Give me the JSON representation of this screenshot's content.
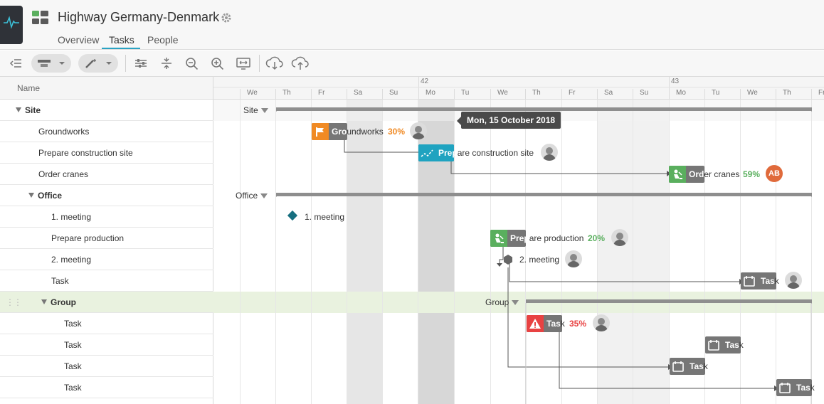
{
  "app": {
    "title": "Highway Germany-Denmark"
  },
  "tabs": [
    {
      "label": "Overview"
    },
    {
      "label": "Tasks"
    },
    {
      "label": "People"
    }
  ],
  "grid": {
    "column_name": "Name",
    "rows": [
      {
        "label": "Site"
      },
      {
        "label": "Groundworks"
      },
      {
        "label": "Prepare construction site"
      },
      {
        "label": "Order cranes"
      },
      {
        "label": "Office"
      },
      {
        "label": "1. meeting"
      },
      {
        "label": "Prepare production"
      },
      {
        "label": "2. meeting"
      },
      {
        "label": "Task"
      },
      {
        "label": "Group"
      },
      {
        "label": "Task"
      },
      {
        "label": "Task"
      },
      {
        "label": "Task"
      },
      {
        "label": "Task"
      }
    ]
  },
  "timeline": {
    "weeks": [
      "42",
      "43"
    ],
    "days": [
      "We",
      "Th",
      "Fr",
      "Sa",
      "Su",
      "Mo",
      "Tu",
      "We",
      "Th",
      "Fr",
      "Sa",
      "Su",
      "Mo",
      "Tu",
      "We",
      "Th",
      "Fr"
    ]
  },
  "tooltip": "Mon, 15 October 2018",
  "chart": {
    "site_label": "Site",
    "office_label": "Office",
    "group_label": "Group",
    "groundworks": {
      "a": "Gro",
      "b": "undworks",
      "pct": "30%"
    },
    "prep_site": {
      "a": "Prep",
      "b": "are construction site"
    },
    "order_cranes": {
      "a": "Ord",
      "b": "er cranes",
      "pct": "59%",
      "avatar": "AB"
    },
    "meeting1": "1. meeting",
    "prep_prod": {
      "a": "Prep",
      "b": "are production",
      "pct": "20%"
    },
    "meeting2": "2. meeting",
    "task_label_a": "Tas",
    "task_label_b": "k",
    "task_red_pct": "35%"
  },
  "colors": {
    "orange": "#f08a24",
    "teal": "#1fa3c0",
    "green": "#5aaf5e",
    "red": "#e84242",
    "bar_gray": "#767676",
    "diamond": "#176f80"
  }
}
